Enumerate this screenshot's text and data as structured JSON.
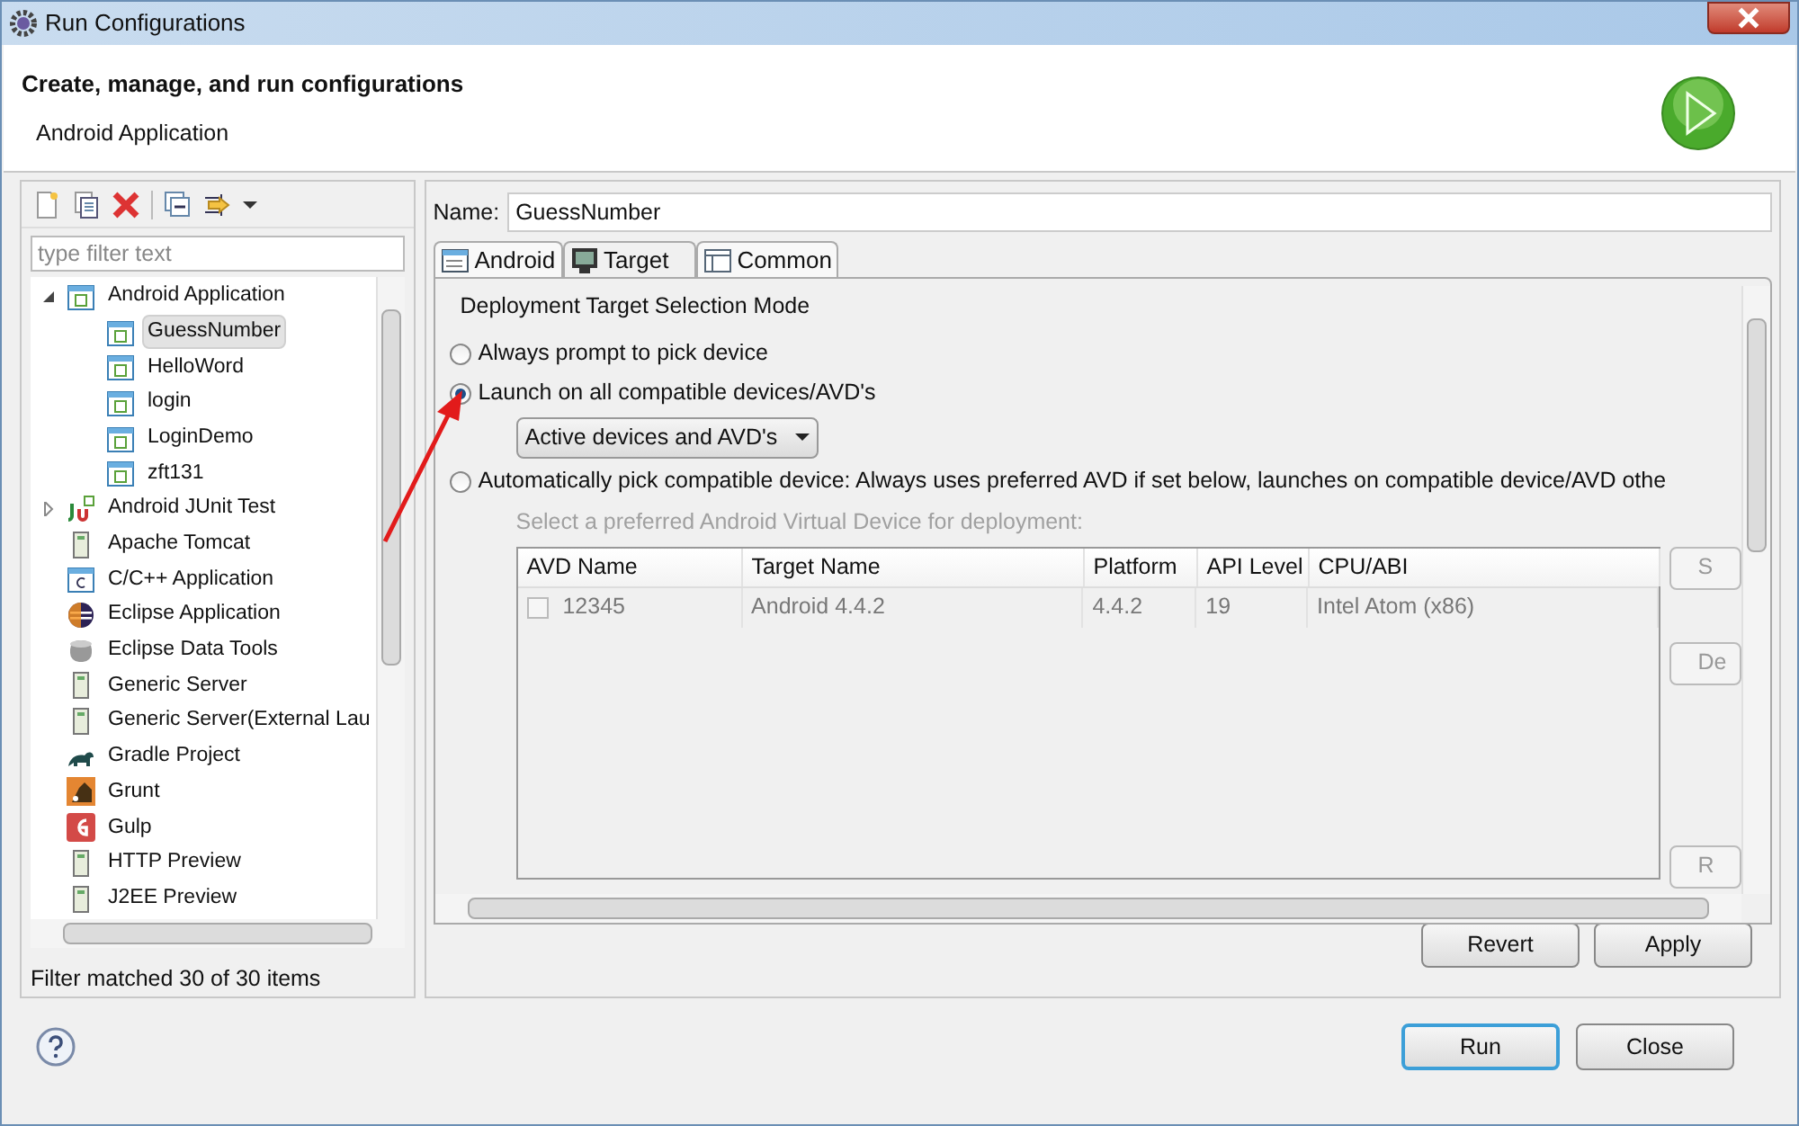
{
  "window": {
    "title": "Run Configurations"
  },
  "header": {
    "title": "Create, manage, and run configurations",
    "subtitle": "Android Application"
  },
  "filter": {
    "placeholder": "type filter text"
  },
  "tree": [
    {
      "label": "Android Application",
      "kind": "android",
      "expanded": true,
      "selected": false,
      "children": [
        {
          "label": "GuessNumber",
          "kind": "android",
          "selected": true
        },
        {
          "label": "HelloWord",
          "kind": "android",
          "selected": false
        },
        {
          "label": "login",
          "kind": "android",
          "selected": false
        },
        {
          "label": "LoginDemo",
          "kind": "android",
          "selected": false
        },
        {
          "label": "zft131",
          "kind": "android",
          "selected": false
        }
      ]
    },
    {
      "label": "Android JUnit Test",
      "kind": "junit",
      "expanded": false,
      "selected": false
    },
    {
      "label": "Apache Tomcat",
      "kind": "server",
      "selected": false
    },
    {
      "label": "C/C++ Application",
      "kind": "c",
      "selected": false
    },
    {
      "label": "Eclipse Application",
      "kind": "eclipse",
      "selected": false
    },
    {
      "label": "Eclipse Data Tools",
      "kind": "database",
      "selected": false
    },
    {
      "label": "Generic Server",
      "kind": "server",
      "selected": false
    },
    {
      "label": "Generic Server(External Lau",
      "kind": "server",
      "selected": false
    },
    {
      "label": "Gradle Project",
      "kind": "gradle",
      "selected": false
    },
    {
      "label": "Grunt",
      "kind": "grunt",
      "selected": false
    },
    {
      "label": "Gulp",
      "kind": "gulp",
      "selected": false
    },
    {
      "label": "HTTP Preview",
      "kind": "server",
      "selected": false
    },
    {
      "label": "J2EE Preview",
      "kind": "server",
      "selected": false
    }
  ],
  "filter_status": "Filter matched 30 of 30 items",
  "name_field": {
    "label": "Name:",
    "value": "GuessNumber"
  },
  "tabs": [
    {
      "label": "Android",
      "kind": "doc",
      "selected": false
    },
    {
      "label": "Target",
      "kind": "monitor",
      "selected": true
    },
    {
      "label": "Common",
      "kind": "table",
      "selected": false
    }
  ],
  "group_title": "Deployment Target Selection Mode",
  "modes": [
    {
      "label": "Always prompt to pick device",
      "selected": false
    },
    {
      "label": "Launch on all compatible devices/AVD's",
      "selected": true,
      "dropdown": "Active devices and AVD's"
    },
    {
      "label": "Automatically pick compatible device: Always uses preferred AVD if set below, launches on compatible device/AVD othe",
      "selected": false
    }
  ],
  "avd_hint": "Select a preferred Android Virtual Device for deployment:",
  "avd_table": {
    "columns": [
      "AVD Name",
      "Target Name",
      "Platform",
      "API Level",
      "CPU/ABI"
    ],
    "rows": [
      {
        "checked": false,
        "cells": [
          "12345",
          "Android 4.4.2",
          "4.4.2",
          "19",
          "Intel Atom (x86)"
        ]
      }
    ]
  },
  "side_buttons": [
    "S",
    "De",
    "R"
  ],
  "buttons": [
    "Revert",
    "Apply"
  ],
  "dialog_buttons": [
    {
      "label": "Run",
      "default": true
    },
    {
      "label": "Close",
      "default": false
    }
  ]
}
